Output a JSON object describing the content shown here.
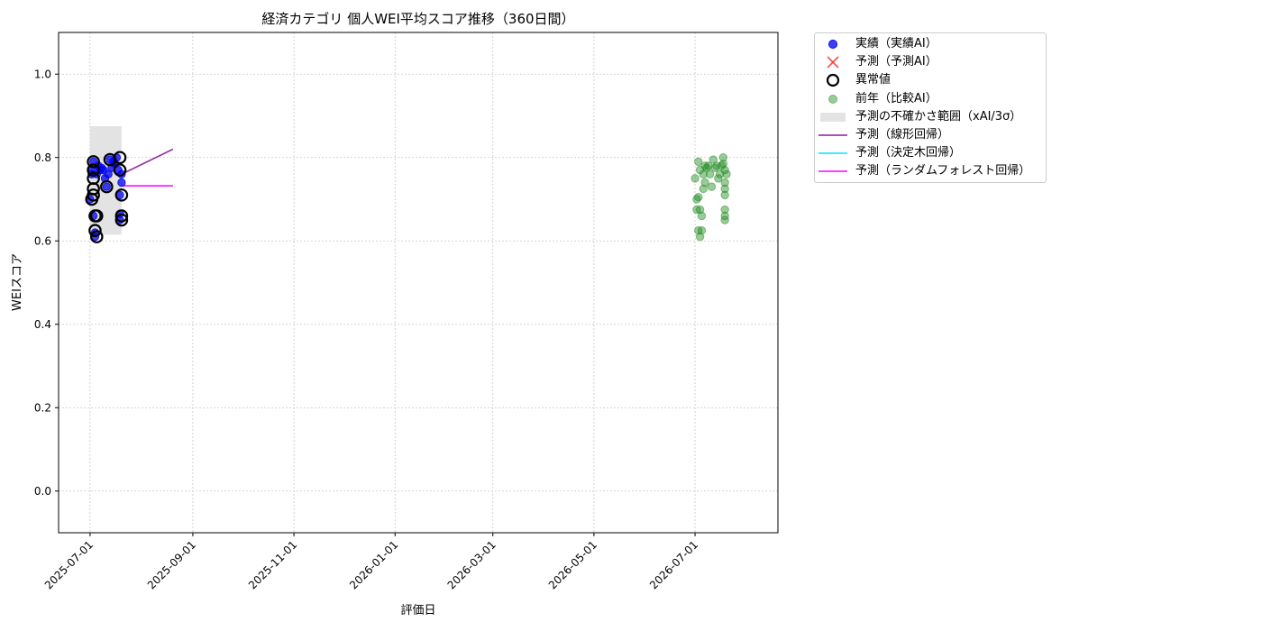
{
  "chart_data": {
    "type": "scatter",
    "title": "経済カテゴリ 個人WEI平均スコア推移（360日間）",
    "xlabel": "評価日",
    "ylabel": "WEIスコア",
    "xlim": [
      "2025-06-12",
      "2026-08-20"
    ],
    "ylim": [
      -0.1,
      1.1
    ],
    "grid": true,
    "legend_placement": "outside-right",
    "x_ticks": [
      "2025-07-01",
      "2025-09-01",
      "2025-11-01",
      "2026-01-01",
      "2026-03-01",
      "2026-05-01",
      "2026-07-01"
    ],
    "y_ticks": [
      "0.0",
      "0.2",
      "0.4",
      "0.6",
      "0.8",
      "1.0"
    ],
    "legend": [
      {
        "key": "actual",
        "label": "実績（実績AI）",
        "color": "#0000ee",
        "symbol": "dot"
      },
      {
        "key": "forecast",
        "label": "予測（予測AI）",
        "color": "#ff3333",
        "symbol": "x"
      },
      {
        "key": "anomaly",
        "label": "異常値",
        "color": "#000000",
        "symbol": "ring"
      },
      {
        "key": "prev_year",
        "label": "前年（比較AI）",
        "color": "#228b22",
        "symbol": "dot-light"
      },
      {
        "key": "uncertainty",
        "label": "予測の不確かさ範囲（xAI/3σ）",
        "color": "#d9d9d9",
        "symbol": "band"
      },
      {
        "key": "linear",
        "label": "予測（線形回帰）",
        "color": "#8b1a9b",
        "symbol": "line"
      },
      {
        "key": "tree",
        "label": "予測（決定木回帰）",
        "color": "#00e5ff",
        "symbol": "line"
      },
      {
        "key": "rf",
        "label": "予測（ランダムフォレスト回帰）",
        "color": "#ff00ff",
        "symbol": "line"
      }
    ],
    "series": [
      {
        "key": "actual",
        "color": "#0000ee",
        "points": [
          [
            "2025-07-01",
            0.7
          ],
          [
            "2025-07-02",
            0.76
          ],
          [
            "2025-07-02",
            0.775
          ],
          [
            "2025-07-03",
            0.79
          ],
          [
            "2025-07-03",
            0.66
          ],
          [
            "2025-07-04",
            0.62
          ],
          [
            "2025-07-04",
            0.61
          ],
          [
            "2025-07-05",
            0.76
          ],
          [
            "2025-07-06",
            0.78
          ],
          [
            "2025-07-07",
            0.77
          ],
          [
            "2025-07-08",
            0.775
          ],
          [
            "2025-07-09",
            0.77
          ],
          [
            "2025-07-10",
            0.75
          ],
          [
            "2025-07-11",
            0.73
          ],
          [
            "2025-07-12",
            0.76
          ],
          [
            "2025-07-13",
            0.795
          ],
          [
            "2025-07-14",
            0.775
          ],
          [
            "2025-07-15",
            0.79
          ],
          [
            "2025-07-16",
            0.785
          ],
          [
            "2025-07-17",
            0.8
          ],
          [
            "2025-07-18",
            0.77
          ],
          [
            "2025-07-19",
            0.71
          ],
          [
            "2025-07-19",
            0.665
          ],
          [
            "2025-07-19",
            0.65
          ],
          [
            "2025-07-20",
            0.76
          ],
          [
            "2025-07-20",
            0.74
          ]
        ]
      },
      {
        "key": "anomaly",
        "color": "#000000",
        "points": [
          [
            "2025-07-02",
            0.7
          ],
          [
            "2025-07-03",
            0.79
          ],
          [
            "2025-07-03",
            0.77
          ],
          [
            "2025-07-03",
            0.75
          ],
          [
            "2025-07-03",
            0.725
          ],
          [
            "2025-07-03",
            0.71
          ],
          [
            "2025-07-04",
            0.66
          ],
          [
            "2025-07-04",
            0.625
          ],
          [
            "2025-07-05",
            0.61
          ],
          [
            "2025-07-05",
            0.66
          ],
          [
            "2025-07-11",
            0.73
          ],
          [
            "2025-07-13",
            0.795
          ],
          [
            "2025-07-19",
            0.8
          ],
          [
            "2025-07-19",
            0.77
          ],
          [
            "2025-07-20",
            0.71
          ],
          [
            "2025-07-20",
            0.66
          ],
          [
            "2025-07-20",
            0.65
          ]
        ]
      },
      {
        "key": "prev_year",
        "color": "#228b22",
        "points": [
          [
            "2026-07-01",
            0.75
          ],
          [
            "2026-07-02",
            0.7
          ],
          [
            "2026-07-02",
            0.675
          ],
          [
            "2026-07-03",
            0.79
          ],
          [
            "2026-07-03",
            0.705
          ],
          [
            "2026-07-03",
            0.625
          ],
          [
            "2026-07-04",
            0.61
          ],
          [
            "2026-07-04",
            0.675
          ],
          [
            "2026-07-04",
            0.77
          ],
          [
            "2026-07-05",
            0.66
          ],
          [
            "2026-07-05",
            0.625
          ],
          [
            "2026-07-06",
            0.76
          ],
          [
            "2026-07-06",
            0.725
          ],
          [
            "2026-07-07",
            0.74
          ],
          [
            "2026-07-07",
            0.78
          ],
          [
            "2026-07-08",
            0.775
          ],
          [
            "2026-07-09",
            0.78
          ],
          [
            "2026-07-10",
            0.76
          ],
          [
            "2026-07-11",
            0.73
          ],
          [
            "2026-07-12",
            0.795
          ],
          [
            "2026-07-13",
            0.775
          ],
          [
            "2026-07-14",
            0.78
          ],
          [
            "2026-07-15",
            0.75
          ],
          [
            "2026-07-16",
            0.76
          ],
          [
            "2026-07-17",
            0.78
          ],
          [
            "2026-07-18",
            0.8
          ],
          [
            "2026-07-18",
            0.785
          ],
          [
            "2026-07-19",
            0.77
          ],
          [
            "2026-07-19",
            0.74
          ],
          [
            "2026-07-19",
            0.725
          ],
          [
            "2026-07-19",
            0.71
          ],
          [
            "2026-07-19",
            0.675
          ],
          [
            "2026-07-19",
            0.66
          ],
          [
            "2026-07-19",
            0.65
          ],
          [
            "2026-07-20",
            0.76
          ]
        ]
      }
    ],
    "forecast_lines": [
      {
        "key": "linear",
        "color": "#8b1a9b",
        "x": [
          "2025-07-20",
          "2025-08-20"
        ],
        "y": [
          0.76,
          0.82
        ]
      },
      {
        "key": "tree",
        "color": "#00e5ff",
        "x": [
          "2025-07-20",
          "2025-08-20"
        ],
        "y": [
          0.732,
          0.732
        ]
      },
      {
        "key": "rf",
        "color": "#ff00ff",
        "x": [
          "2025-07-20",
          "2025-08-20"
        ],
        "y": [
          0.732,
          0.732
        ]
      }
    ],
    "uncertainty_band": {
      "color": "#d9d9d9",
      "x": [
        "2025-07-01",
        "2025-07-20"
      ],
      "y": [
        0.615,
        0.875
      ]
    }
  }
}
